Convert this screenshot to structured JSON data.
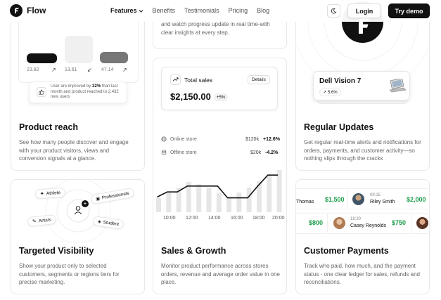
{
  "nav": {
    "brand": "Flow",
    "links": [
      "Features",
      "Benefits",
      "Testimonials",
      "Pricing",
      "Blog"
    ],
    "login": "Login",
    "cta": "Try demo"
  },
  "reach": {
    "bars": [
      {
        "value": "23.82",
        "arrow": "↗",
        "color": "#111111"
      },
      {
        "value": "13.61",
        "arrow": "↙",
        "color": "#f0f0f0"
      },
      {
        "value": "47.14",
        "arrow": "↗",
        "color": "#777777"
      }
    ],
    "tooltip_pre": "User are improved by ",
    "tooltip_bold": "32%",
    "tooltip_post": " than last month and product reached to 2,432 new users",
    "title": "Product reach",
    "desc": "See how many people discover and engage with your product visitors, views and conversion signals at a glance."
  },
  "progress": {
    "desc_fragment": "and watch progress update in real time-with clear insights at every step."
  },
  "visibility": {
    "chips": [
      "Athlete",
      "Professionals",
      "Artists",
      "Student"
    ],
    "title": "Targeted Visibility",
    "desc": "Show your product only to selected customers, segments or regions tiers for precise marketing."
  },
  "sales": {
    "widget_label": "Total sales",
    "details": "Details",
    "amount": "$2,150.00",
    "change": "+5%",
    "rows": [
      {
        "label": "Online store",
        "value": "$120k",
        "pct": "+12.6%"
      },
      {
        "label": "Offline store",
        "value": "$20k",
        "pct": "-4.2%"
      }
    ],
    "times": [
      "10:00",
      "12:00",
      "14:00",
      "16:00",
      "18:00",
      "20:00"
    ],
    "bar_levels": [
      0.34,
      0.46,
      0.58,
      0.72,
      0.66,
      0.58,
      0.46,
      0.36,
      0.46,
      0.58,
      0.74,
      0.88,
      1.0
    ],
    "line_levels": [
      0.36,
      0.48,
      0.48,
      0.62,
      0.62,
      0.62,
      0.62,
      0.34,
      0.34,
      0.34,
      0.62,
      0.88,
      0.88
    ],
    "title": "Sales & Growth",
    "desc": "Monitor product performance across stores orders, revenue and average order value in one place."
  },
  "updates": {
    "product": "Dell Vision 7",
    "change": "5.6%",
    "title": "Regular Updates",
    "desc": "Get regular real-time alerts and notifications for orders, payments, and customer activity—so nothing slips through the cracks"
  },
  "payments": {
    "row1": [
      {
        "name": "Thomas",
        "amount": "$1,500"
      },
      {
        "name": "Riley Smith",
        "time": "09:15",
        "amount": "$2,000"
      }
    ],
    "row2": [
      {
        "amount": "$800"
      },
      {
        "name": "Casey Reynolds",
        "time": "18:30",
        "amount": "$750"
      }
    ],
    "title": "Customer Payments",
    "desc": "Track who paid, how much, and the payment status - one clear ledger for sales, refunds and reconciliations."
  }
}
